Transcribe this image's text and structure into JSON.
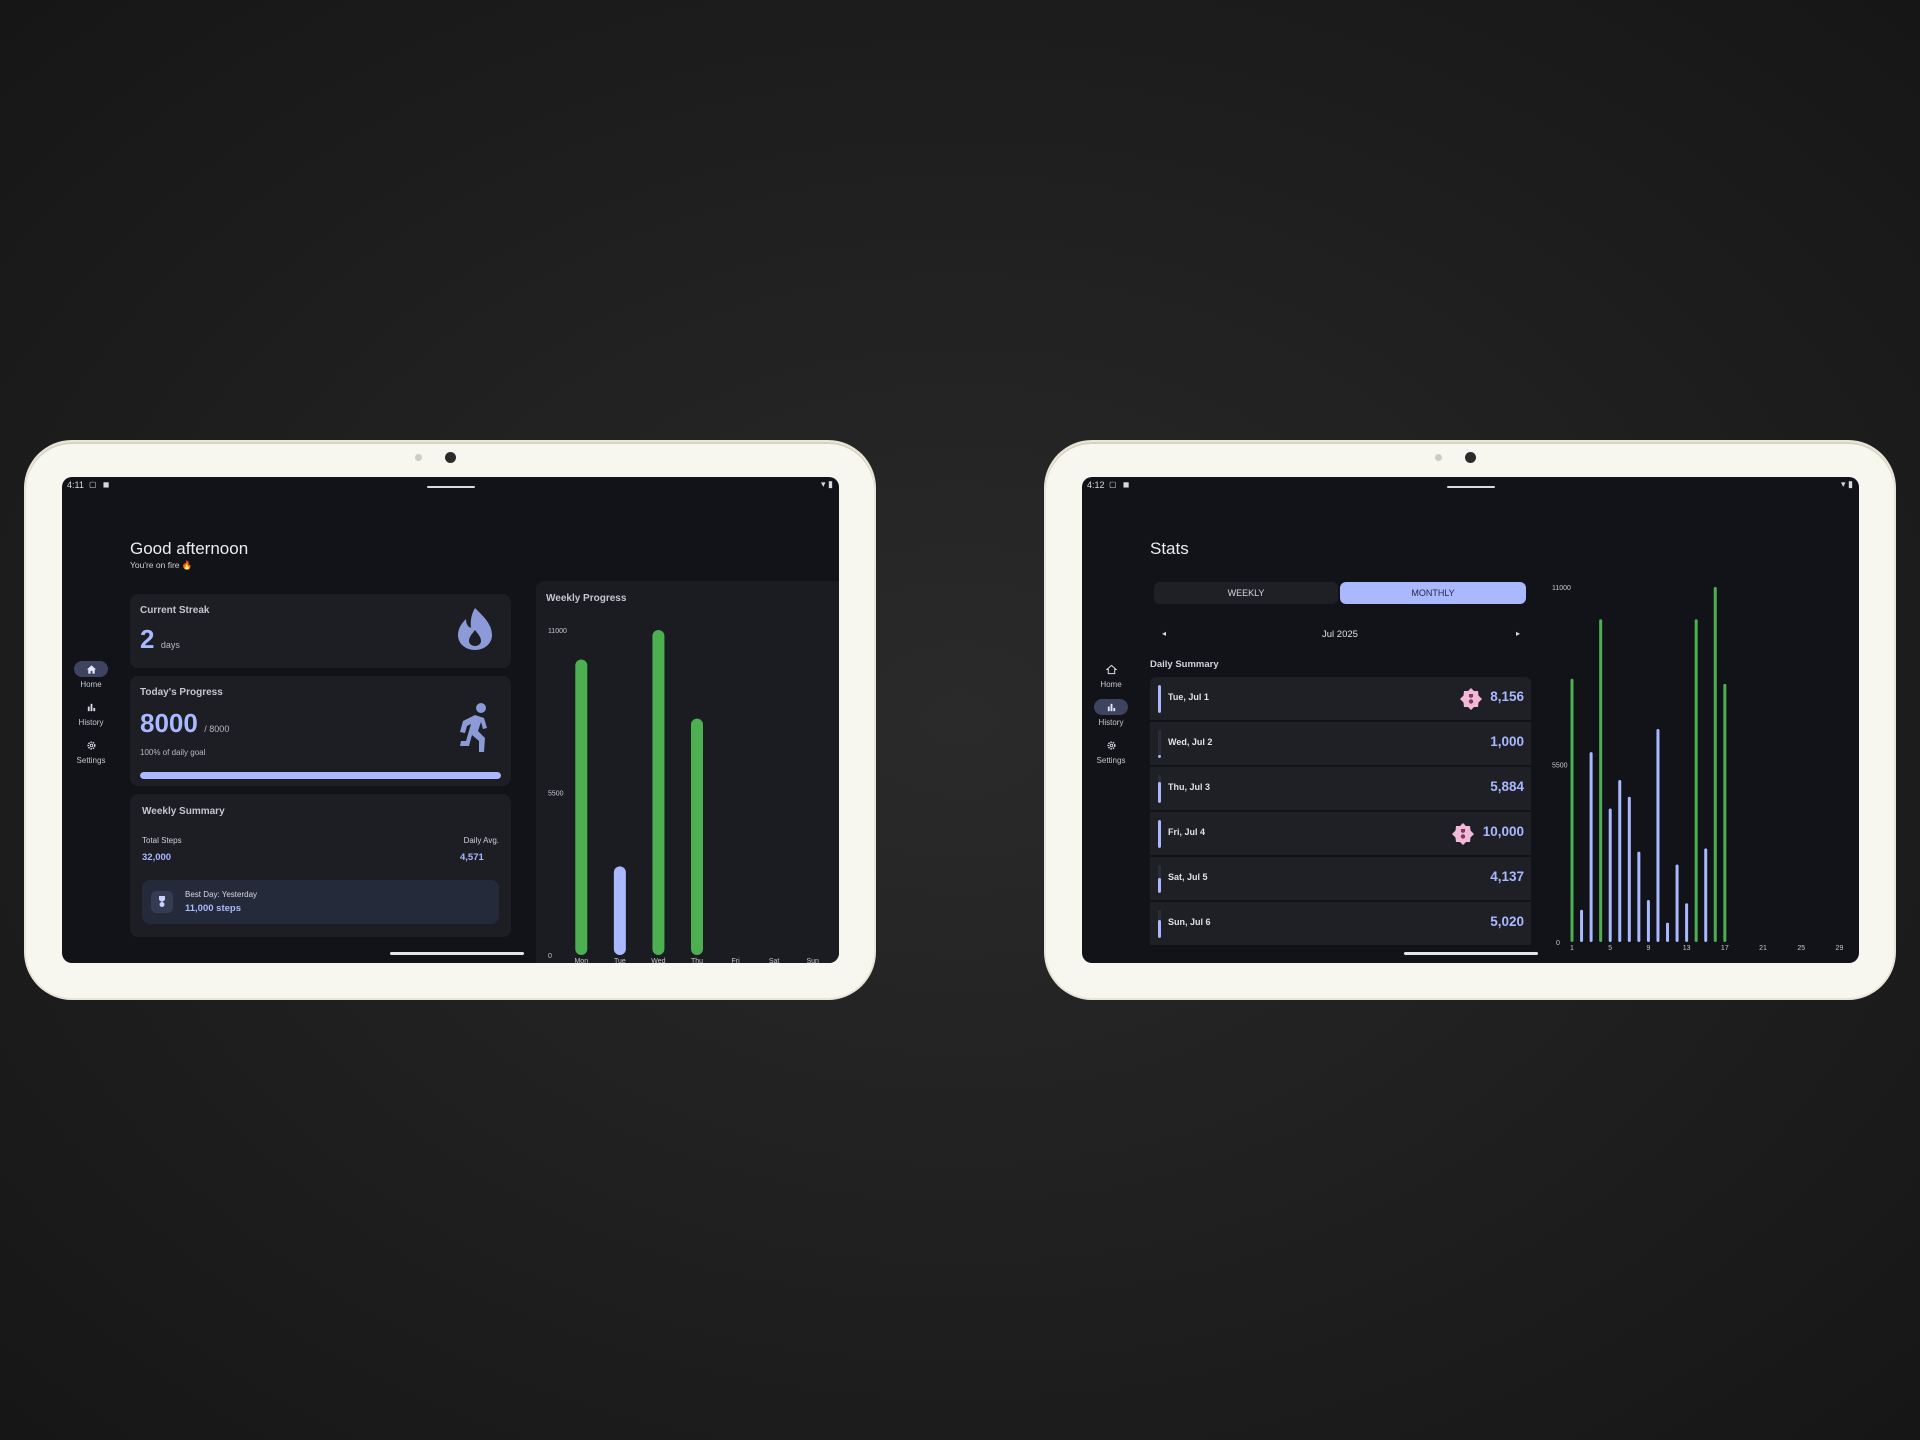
{
  "colors": {
    "accent": "#a9b8ff",
    "green": "#4caf50",
    "panel": "#1c1e24",
    "badge": "#f2b8d8"
  },
  "left": {
    "status": {
      "time": "4:11"
    },
    "nav": [
      {
        "label": "Home",
        "icon": "home-icon",
        "active": true
      },
      {
        "label": "History",
        "icon": "bar-chart-icon",
        "active": false
      },
      {
        "label": "Settings",
        "icon": "gear-icon",
        "active": false
      }
    ],
    "greeting": "Good afternoon",
    "subtitle": "You're on fire 🔥",
    "streak": {
      "title": "Current Streak",
      "value": "2",
      "unit": "days",
      "icon": "fire-icon"
    },
    "progress": {
      "title": "Today's Progress",
      "value": "8000",
      "goal": "/ 8000",
      "caption": "100% of daily goal",
      "fraction": 1.0,
      "icon": "running-icon"
    },
    "summary": {
      "title": "Weekly Summary",
      "total_label": "Total Steps",
      "total_value": "32,000",
      "avg_label": "Daily Avg.",
      "avg_value": "4,571",
      "best_label": "Best Day: Yesterday",
      "best_value": "11,000 steps",
      "best_icon": "medal-icon"
    },
    "chart_data": {
      "type": "bar",
      "title": "Weekly Progress",
      "categories": [
        "Mon",
        "Tue",
        "Wed",
        "Thu",
        "Fri",
        "Sat",
        "Sun"
      ],
      "values": [
        10000,
        3000,
        11000,
        8000,
        0,
        0,
        0
      ],
      "goal_met": [
        true,
        false,
        true,
        true,
        false,
        false,
        false
      ],
      "ylim": [
        0,
        11000
      ],
      "yticks": [
        "11000",
        "5500",
        "0"
      ]
    }
  },
  "right": {
    "status": {
      "time": "4:12"
    },
    "nav": [
      {
        "label": "Home",
        "icon": "home-icon",
        "active": false
      },
      {
        "label": "History",
        "icon": "bar-chart-icon",
        "active": true
      },
      {
        "label": "Settings",
        "icon": "gear-icon",
        "active": false
      }
    ],
    "title": "Stats",
    "tabs": [
      {
        "label": "WEEKLY",
        "active": false
      },
      {
        "label": "MONTHLY",
        "active": true
      }
    ],
    "month": "Jul 2025",
    "section": "Daily Summary",
    "rows": [
      {
        "date": "Tue, Jul 1",
        "value": "8,156",
        "badge": true,
        "fraction": 1.0
      },
      {
        "date": "Wed, Jul 2",
        "value": "1,000",
        "badge": false,
        "fraction": 0.12
      },
      {
        "date": "Thu, Jul 3",
        "value": "5,884",
        "badge": false,
        "fraction": 0.74
      },
      {
        "date": "Fri, Jul 4",
        "value": "10,000",
        "badge": true,
        "fraction": 1.0
      },
      {
        "date": "Sat, Jul 5",
        "value": "4,137",
        "badge": false,
        "fraction": 0.52
      },
      {
        "date": "Sun, Jul 6",
        "value": "5,020",
        "badge": false,
        "fraction": 0.63
      }
    ],
    "chart_data": {
      "type": "bar",
      "x": [
        1,
        2,
        3,
        4,
        5,
        6,
        7,
        8,
        9,
        10,
        11,
        12,
        13,
        14,
        15,
        16,
        17
      ],
      "values": [
        8156,
        1000,
        5884,
        10000,
        4137,
        5020,
        4500,
        2800,
        1300,
        6600,
        600,
        2400,
        1200,
        10000,
        2900,
        11000,
        8000
      ],
      "goal_met": [
        true,
        false,
        false,
        true,
        false,
        false,
        false,
        false,
        false,
        false,
        false,
        false,
        false,
        true,
        false,
        true,
        true
      ],
      "xticks": [
        "1",
        "5",
        "9",
        "13",
        "17",
        "21",
        "25",
        "29"
      ],
      "xlim": [
        1,
        30
      ],
      "ylim": [
        0,
        11000
      ],
      "yticks": [
        "11000",
        "5500",
        "0"
      ]
    }
  }
}
